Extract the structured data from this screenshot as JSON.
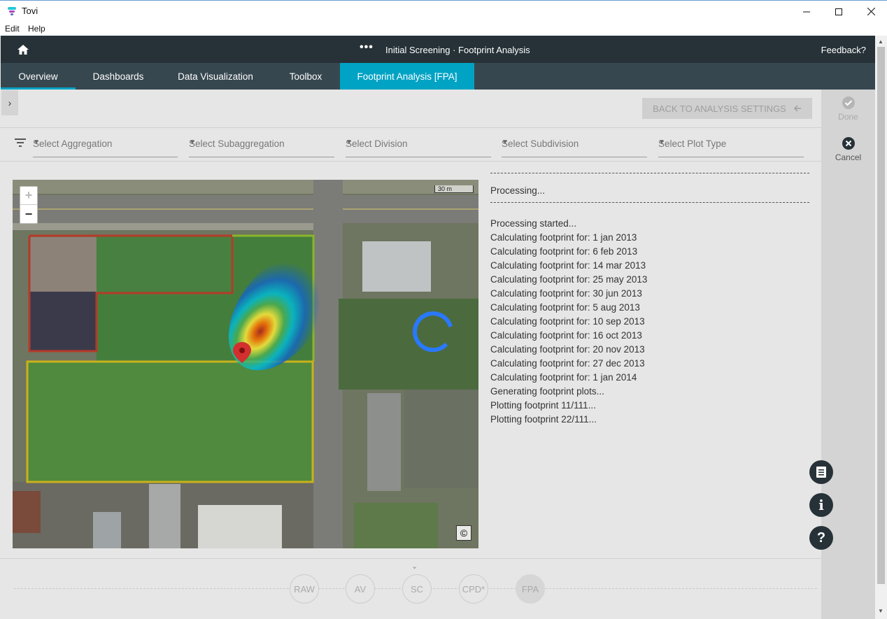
{
  "window": {
    "title": "Tovi",
    "minimize_icon": "minimize-icon",
    "maximize_icon": "maximize-icon",
    "close_icon": "close-icon"
  },
  "menu": {
    "items": [
      "Edit",
      "Help"
    ]
  },
  "header": {
    "breadcrumb": "Initial Screening · Footprint Analysis",
    "more": "•••",
    "feedback": "Feedback?",
    "home_icon": "home-icon"
  },
  "tabs": [
    {
      "label": "Overview"
    },
    {
      "label": "Dashboards"
    },
    {
      "label": "Data Visualization"
    },
    {
      "label": "Toolbox"
    },
    {
      "label": "Footprint Analysis [FPA]",
      "active": true
    }
  ],
  "toolbar": {
    "back_label": "BACK TO ANALYSIS SETTINGS",
    "expand_glyph": "›"
  },
  "filters": {
    "aggregation": {
      "placeholder": "Select Aggregation"
    },
    "subaggregation": {
      "placeholder": "Select Subaggregation"
    },
    "division": {
      "placeholder": "Select Division"
    },
    "subdivision": {
      "placeholder": "Select Subdivision"
    },
    "plot_type": {
      "placeholder": "Select Plot Type"
    }
  },
  "map": {
    "zoom_in": "+",
    "zoom_out": "−",
    "scale": "30 m",
    "copyright": "©"
  },
  "log": {
    "status": "Processing...",
    "lines": [
      "Processing started...",
      "Calculating footprint for: 1 jan 2013",
      "Calculating footprint for: 6 feb 2013",
      "Calculating footprint for: 14 mar 2013",
      "Calculating footprint for: 25 may 2013",
      "Calculating footprint for: 30 jun 2013",
      "Calculating footprint for: 5 aug 2013",
      "Calculating footprint for: 10 sep 2013",
      "Calculating footprint for: 16 oct 2013",
      "Calculating footprint for: 20 nov 2013",
      "Calculating footprint for: 27 dec 2013",
      "Calculating footprint for: 1 jan 2014",
      "Generating footprint plots...",
      "Plotting footprint 11/111...",
      "Plotting footprint 22/111..."
    ]
  },
  "rail": {
    "done_label": "Done",
    "cancel_label": "Cancel",
    "notes_icon": "document-icon",
    "info_glyph": "i",
    "help_glyph": "?"
  },
  "pipeline": {
    "stages": [
      "RAW",
      "AV",
      "SC",
      "CPD*",
      "FPA"
    ],
    "active_stage": "FPA"
  },
  "colors": {
    "header": "#263238",
    "tabs": "#37474f",
    "accent": "#00a3c4",
    "spinner": "#2979ff"
  }
}
